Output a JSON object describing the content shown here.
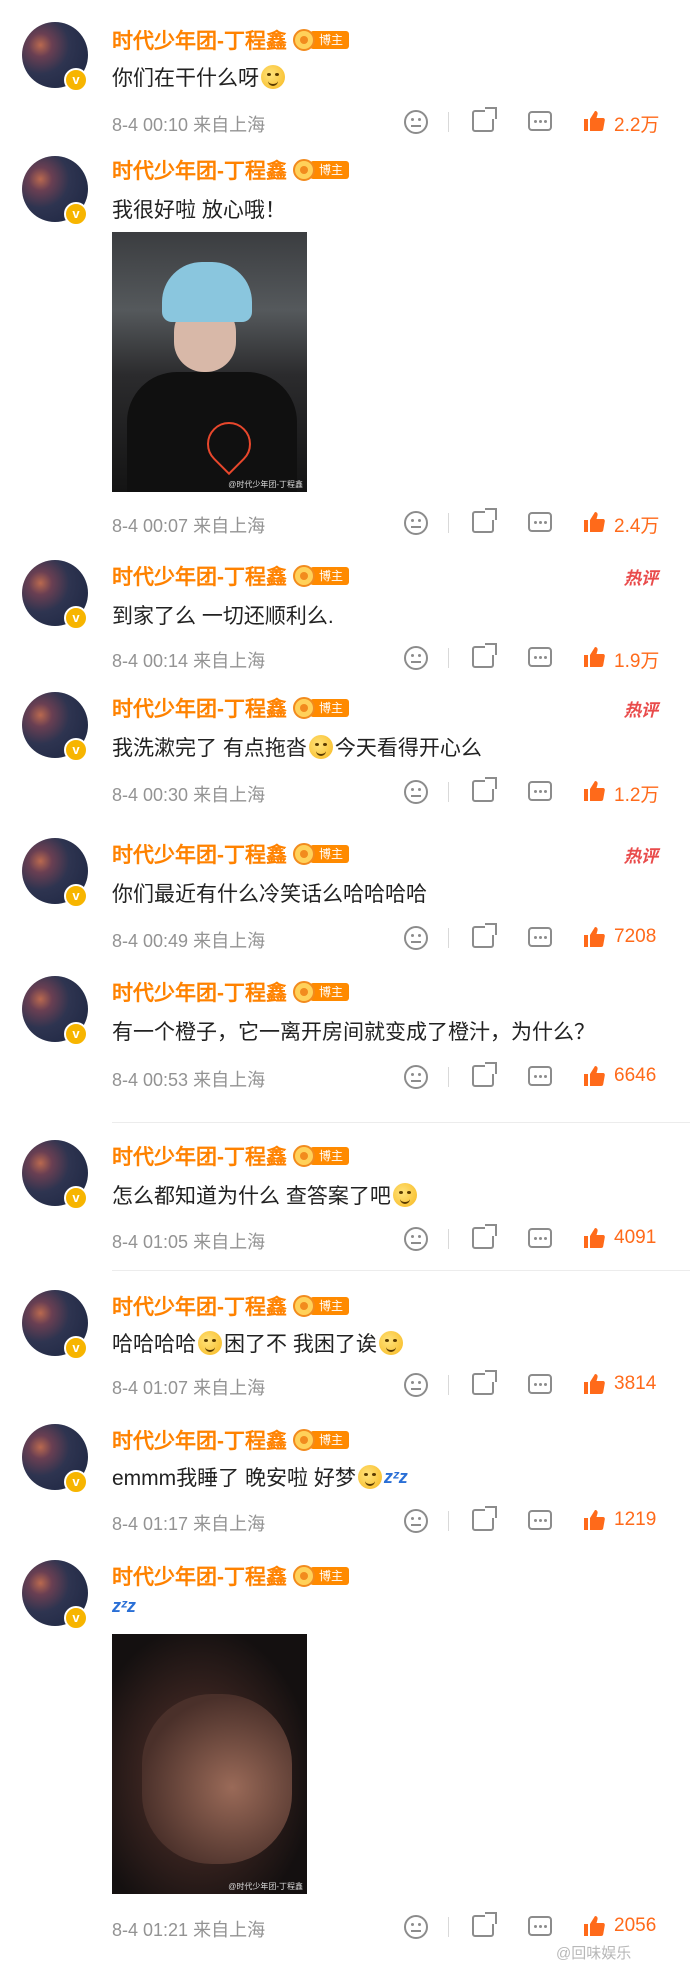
{
  "author": {
    "name": "时代少年团-丁程鑫",
    "badge_label": "博主",
    "verified_mark": "v"
  },
  "hot_label": "热评",
  "comments": [
    {
      "text": "你们在干什么呀",
      "emoji_after": true,
      "date": "8-4 00:10",
      "location": "来自上海",
      "likes": "2.2万",
      "hot": false
    },
    {
      "text": "我很好啦 放心哦！",
      "date": "8-4 00:07",
      "location": "来自上海",
      "likes": "2.4万",
      "hot": false,
      "photo_watermark": "@时代少年团-丁程鑫"
    },
    {
      "text": "到家了么 一切还顺利么.",
      "date": "8-4 00:14",
      "location": "来自上海",
      "likes": "1.9万",
      "hot": true
    },
    {
      "text_a": "我洗漱完了 有点拖沓",
      "text_b": "今天看得开心么",
      "date": "8-4 00:30",
      "location": "来自上海",
      "likes": "1.2万",
      "hot": true
    },
    {
      "text": "你们最近有什么冷笑话么哈哈哈哈",
      "date": "8-4 00:49",
      "location": "来自上海",
      "likes": "7208",
      "hot": true
    },
    {
      "text": "有一个橙子，它一离开房间就变成了橙汁，为什么？",
      "date": "8-4 00:53",
      "location": "来自上海",
      "likes": "6646",
      "hot": false
    },
    {
      "text": "怎么都知道为什么 查答案了吧",
      "date": "8-4 01:05",
      "location": "来自上海",
      "likes": "4091",
      "hot": false
    },
    {
      "text_a": "哈哈哈哈",
      "text_b": "困了不 我困了诶",
      "date": "8-4 01:07",
      "location": "来自上海",
      "likes": "3814",
      "hot": false
    },
    {
      "text": "emmm我睡了 晚安啦 好梦",
      "zzz": "zᶻz",
      "date": "8-4 01:17",
      "location": "来自上海",
      "likes": "1219",
      "hot": false
    },
    {
      "zzz": "zᶻz",
      "date": "8-4 01:21",
      "location": "来自上海",
      "likes": "2056",
      "hot": false,
      "photo_watermark": "@时代少年团-丁程鑫"
    }
  ],
  "page_watermark": "@回味娱乐",
  "colors": {
    "username": "#ff8200",
    "like": "#ff6a1a",
    "hot": "#e94b4b",
    "meta": "#939393"
  },
  "icons": [
    "face-icon",
    "share-icon",
    "comment-icon",
    "like-icon",
    "crown-icon"
  ]
}
